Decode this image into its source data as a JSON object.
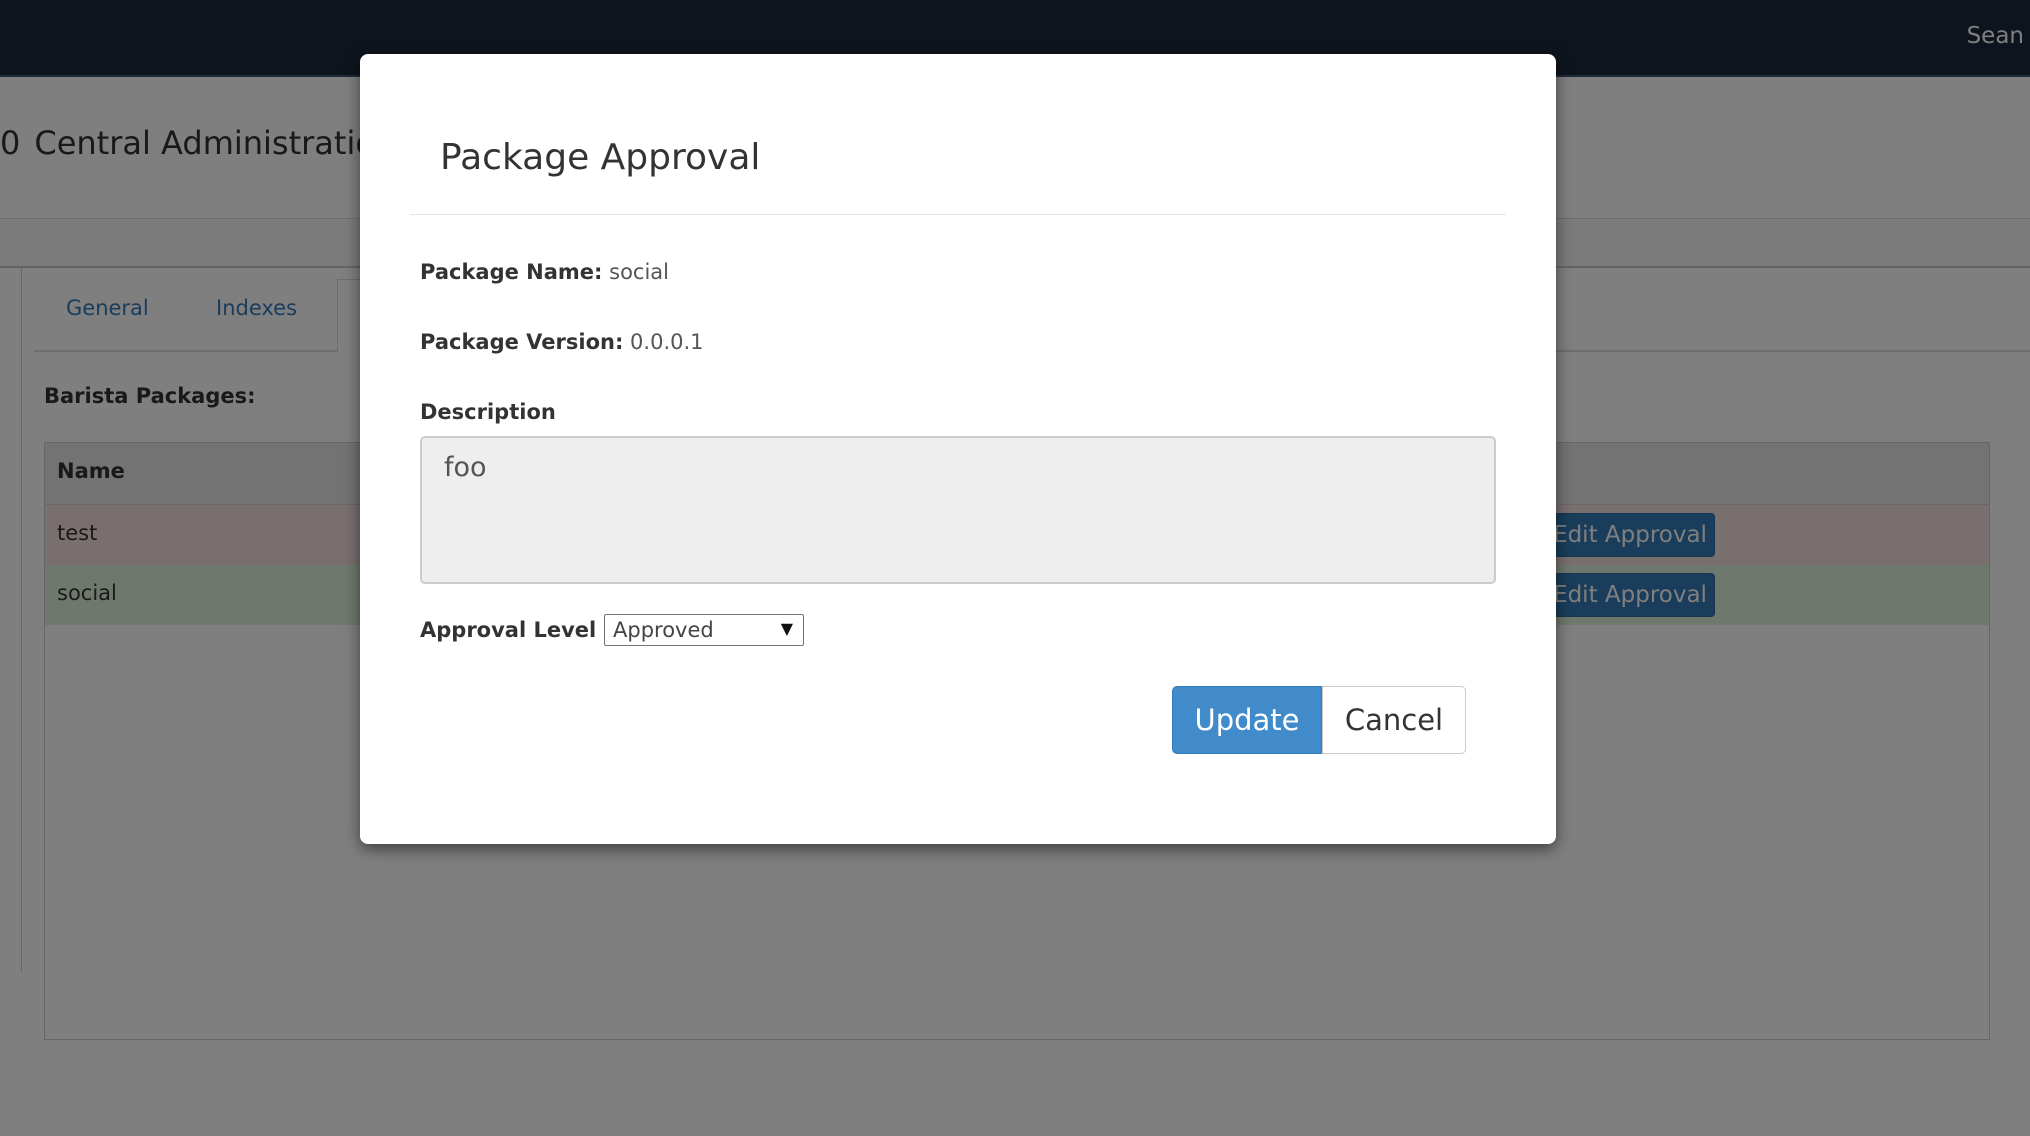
{
  "topbar": {
    "user_name": "Sean"
  },
  "page": {
    "title_prefix": "0",
    "title": "Central Administration"
  },
  "tabs": [
    {
      "label": "General"
    },
    {
      "label": "Indexes"
    }
  ],
  "packages": {
    "section_label": "Barista Packages:",
    "column_name": "Name",
    "rows": [
      {
        "name": "test",
        "status": "rejected",
        "action_label": "Edit Approval"
      },
      {
        "name": "social",
        "status": "approved",
        "action_label": "Edit Approval"
      }
    ]
  },
  "modal": {
    "title": "Package Approval",
    "package_name_label": "Package Name:",
    "package_name": "social",
    "package_version_label": "Package Version:",
    "package_version": "0.0.0.1",
    "description_label": "Description",
    "description_value": "foo",
    "approval_level_label": "Approval Level",
    "approval_level_value": "Approved",
    "update_label": "Update",
    "cancel_label": "Cancel"
  },
  "colors": {
    "topbar": "#1c283b",
    "primary": "#428bca",
    "row_rejected": "#f2dede",
    "row_approved": "#dff0d8"
  }
}
